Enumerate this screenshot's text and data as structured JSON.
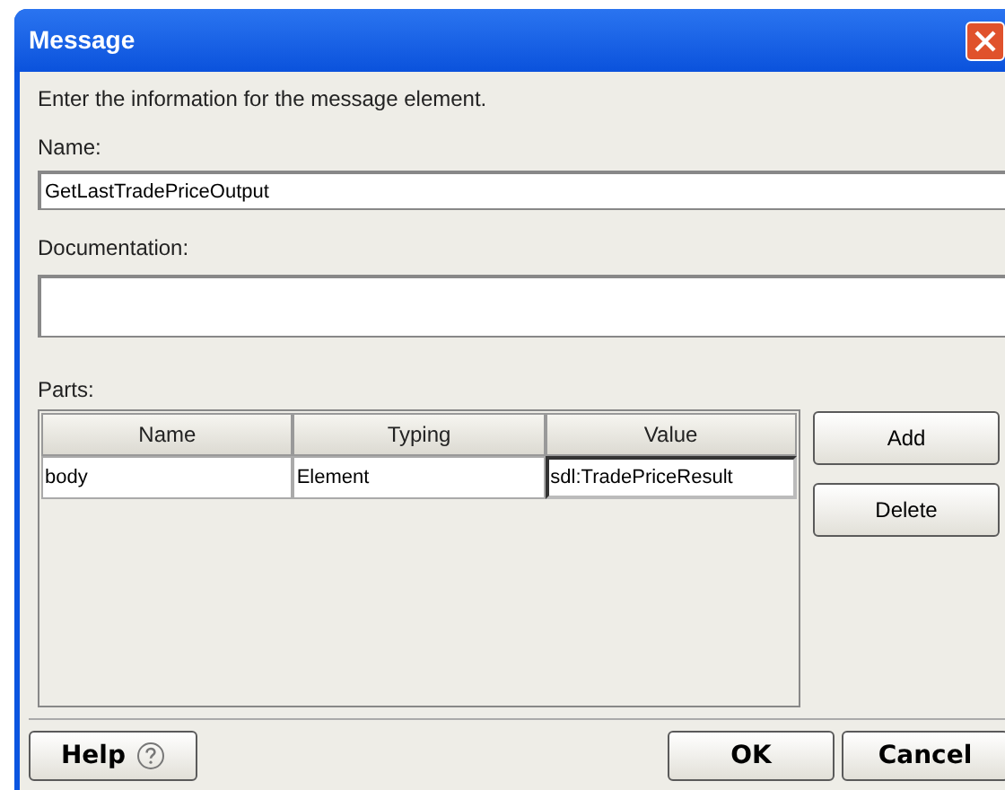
{
  "window": {
    "title": "Message"
  },
  "instruction": "Enter the information for the message element.",
  "name": {
    "label": "Name:",
    "value": "GetLastTradePriceOutput"
  },
  "documentation": {
    "label": "Documentation:"
  },
  "parts": {
    "label": "Parts:",
    "columns": [
      "Name",
      "Typing",
      "Value"
    ],
    "rows": [
      {
        "cells": [
          {
            "text": "body",
            "editing": false
          },
          {
            "text": "Element",
            "editing": false
          },
          {
            "text": "sdl:TradePriceResult",
            "editing": true
          }
        ]
      }
    ],
    "buttons": [
      "Add",
      "Delete"
    ]
  },
  "footer": {
    "help": "Help",
    "buttons": [
      "OK",
      "Cancel"
    ]
  }
}
